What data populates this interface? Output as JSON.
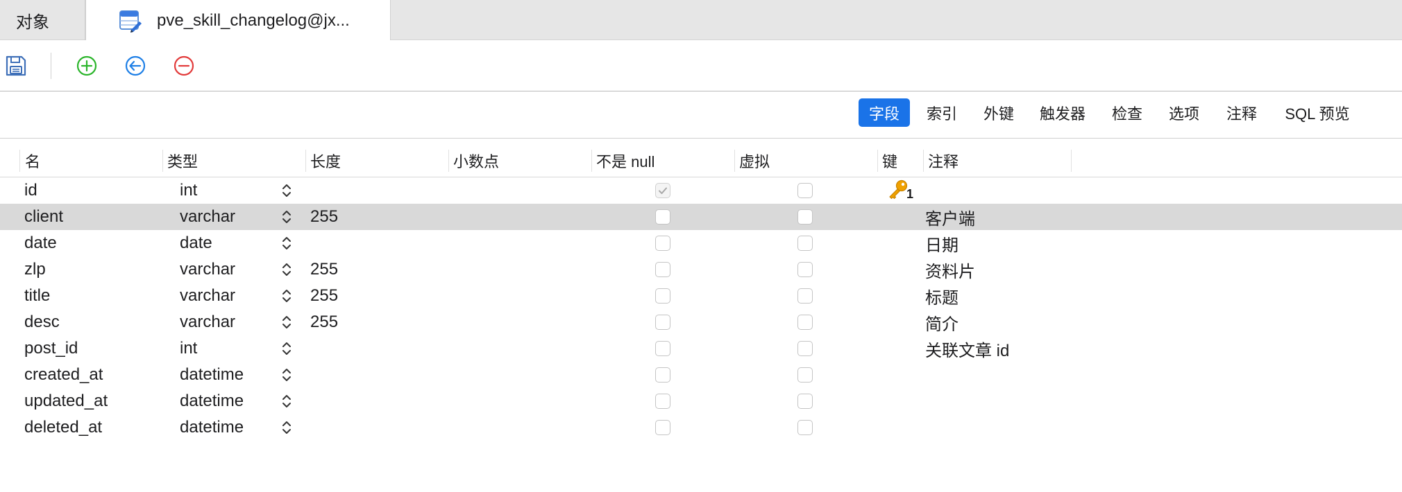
{
  "tabs": {
    "objects_label": "对象",
    "active_label": "pve_skill_changelog@jx..."
  },
  "subtabs": [
    {
      "label": "字段",
      "active": true
    },
    {
      "label": "索引",
      "active": false
    },
    {
      "label": "外键",
      "active": false
    },
    {
      "label": "触发器",
      "active": false
    },
    {
      "label": "检查",
      "active": false
    },
    {
      "label": "选项",
      "active": false
    },
    {
      "label": "注释",
      "active": false
    },
    {
      "label": "SQL 预览",
      "active": false
    }
  ],
  "columns": {
    "name": "名",
    "type": "类型",
    "length": "长度",
    "decimals": "小数点",
    "not_null": "不是 null",
    "virtual": "虚拟",
    "key": "键",
    "comment": "注释"
  },
  "rows": [
    {
      "name": "id",
      "type": "int",
      "length": "",
      "not_null": true,
      "virtual": false,
      "key": "1",
      "comment": ""
    },
    {
      "name": "client",
      "type": "varchar",
      "length": "255",
      "not_null": false,
      "virtual": false,
      "key": "",
      "comment": "客户端"
    },
    {
      "name": "date",
      "type": "date",
      "length": "",
      "not_null": false,
      "virtual": false,
      "key": "",
      "comment": "日期"
    },
    {
      "name": "zlp",
      "type": "varchar",
      "length": "255",
      "not_null": false,
      "virtual": false,
      "key": "",
      "comment": "资料片"
    },
    {
      "name": "title",
      "type": "varchar",
      "length": "255",
      "not_null": false,
      "virtual": false,
      "key": "",
      "comment": "标题"
    },
    {
      "name": "desc",
      "type": "varchar",
      "length": "255",
      "not_null": false,
      "virtual": false,
      "key": "",
      "comment": "简介"
    },
    {
      "name": "post_id",
      "type": "int",
      "length": "",
      "not_null": false,
      "virtual": false,
      "key": "",
      "comment": "关联文章 id"
    },
    {
      "name": "created_at",
      "type": "datetime",
      "length": "",
      "not_null": false,
      "virtual": false,
      "key": "",
      "comment": ""
    },
    {
      "name": "updated_at",
      "type": "datetime",
      "length": "",
      "not_null": false,
      "virtual": false,
      "key": "",
      "comment": ""
    },
    {
      "name": "deleted_at",
      "type": "datetime",
      "length": "",
      "not_null": false,
      "virtual": false,
      "key": "",
      "comment": ""
    }
  ],
  "selected_row": 1,
  "colors": {
    "accent": "#1a73e8",
    "add": "#2bb52b",
    "insert": "#1e7fe6",
    "delete": "#e23b3b",
    "key": "#f0a100",
    "selected_row": "#d9d9d9"
  },
  "icons": {
    "tab": "table-design-icon",
    "save": "save-icon",
    "add": "add-field-icon",
    "insert": "insert-field-icon",
    "delete": "delete-field-icon",
    "stepper": "stepper-icon",
    "key": "primary-key-icon"
  }
}
